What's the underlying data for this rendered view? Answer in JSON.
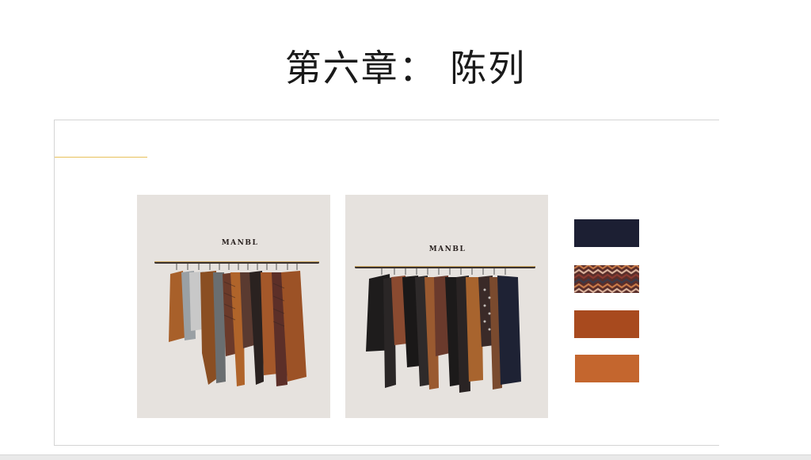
{
  "slide": {
    "title": "第六章：  陈列"
  },
  "panels": [
    {
      "brand": "MANBL"
    },
    {
      "brand": "MANBL"
    }
  ],
  "swatches": [
    {
      "name": "navy",
      "color": "#1c1f33"
    },
    {
      "name": "zigzag-knit",
      "color": "#8a4a3a"
    },
    {
      "name": "rust",
      "color": "#a84a1e"
    },
    {
      "name": "tan-orange",
      "color": "#c4662e"
    }
  ],
  "colors": {
    "accent": "#e8c15a",
    "panel_bg": "#e6e2de"
  }
}
